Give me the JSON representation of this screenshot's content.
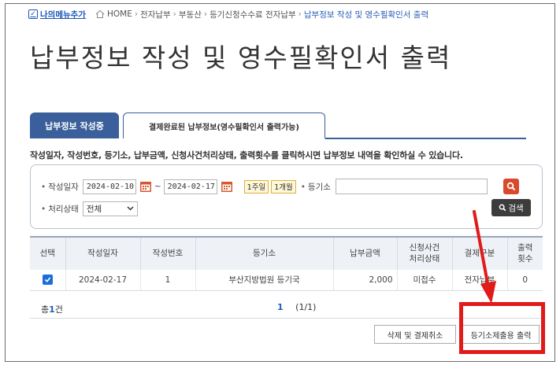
{
  "breadcrumb": {
    "my_menu": "나의메뉴추가",
    "items": [
      "HOME",
      "전자납부",
      "부동산",
      "등기신청수수료 전자납부"
    ],
    "current": "납부정보 작성 및 영수필확인서 출력"
  },
  "page_title": "납부정보 작성 및 영수필확인서 출력",
  "tabs": [
    {
      "label": "납부정보 작성중"
    },
    {
      "label": "결제완료된 납부정보(영수필확인서 출력가능)"
    }
  ],
  "notice": "작성일자, 작성번호, 등기소, 납부금액, 신청사건처리상태, 출력횟수를 클릭하시면 납부정보 내역을 확인하실 수 있습니다.",
  "search": {
    "date_label": "작성일자",
    "date_from": "2024-02-10",
    "date_sep": "~",
    "date_to": "2024-02-17",
    "period_1week": "1주일",
    "period_1month": "1개월",
    "registry_label": "등기소",
    "registry_value": "",
    "state_label": "처리상태",
    "state_value": "전체",
    "search_button": "검색"
  },
  "table": {
    "headers": [
      "선택",
      "작성일자",
      "작성번호",
      "등기소",
      "납부금액",
      "신청사건\n처리상태",
      "결제구분",
      "출력\n횟수"
    ],
    "rows": [
      {
        "checked": true,
        "date": "2024-02-17",
        "number": "1",
        "registry": "부산지방법원 등기국",
        "amount": "2,000",
        "state": "미접수",
        "payment": "전자납부",
        "count": "0"
      }
    ]
  },
  "total": {
    "prefix": "총",
    "count": "1",
    "suffix": "건"
  },
  "pagination": {
    "current": "1",
    "info": "(1/1)"
  },
  "buttons": {
    "cancel": "삭제 및 결제취소",
    "print": "등기소제출용 출력"
  },
  "colors": {
    "accent_blue": "#3a5f9a",
    "annotation_red": "#e11a1a",
    "search_red": "#d94a2c"
  }
}
